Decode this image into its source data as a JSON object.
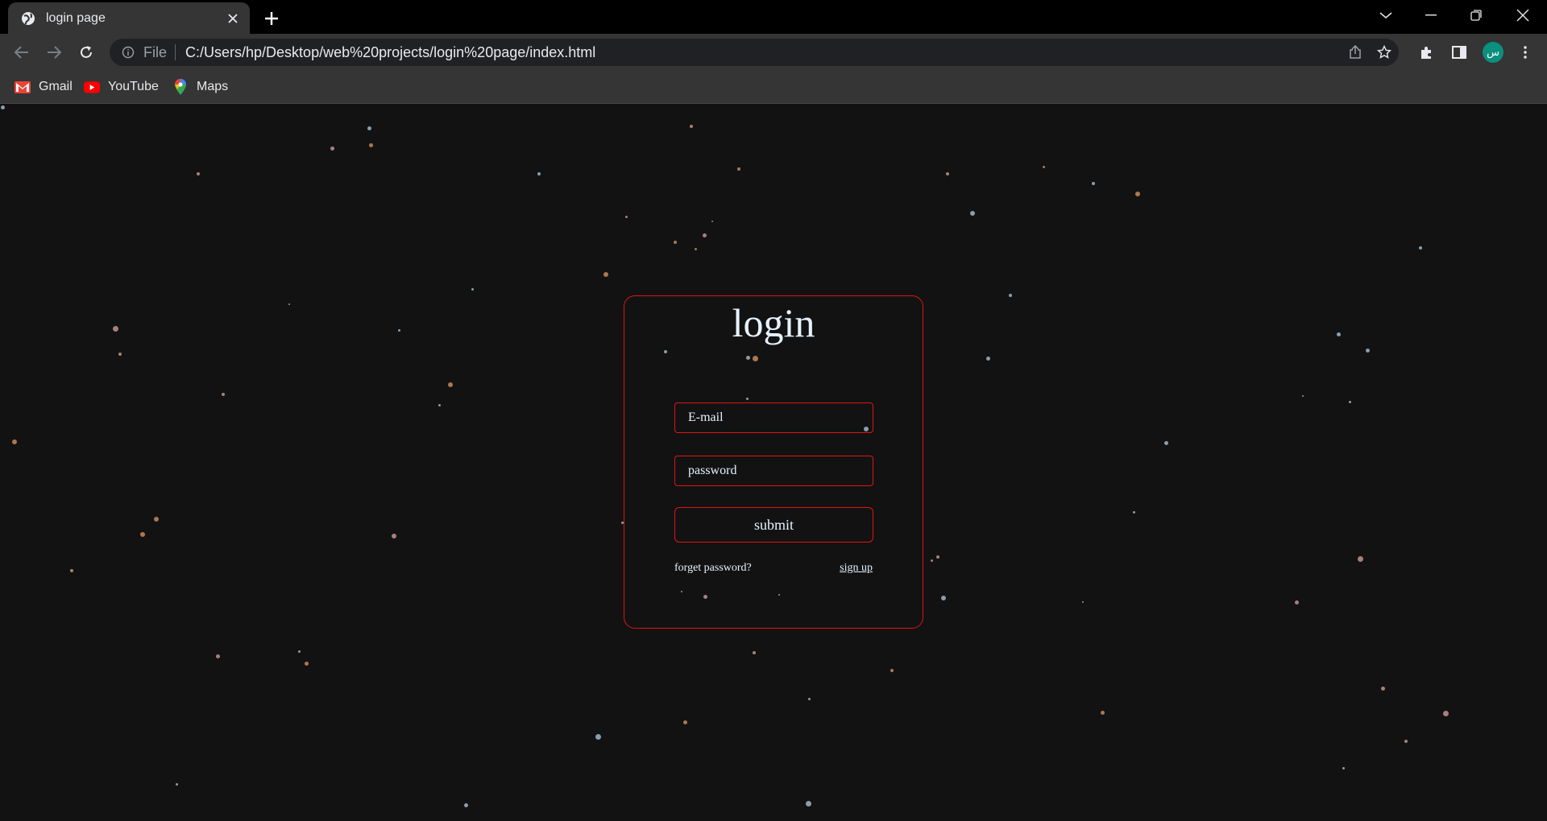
{
  "browser": {
    "tab": {
      "title": "login page",
      "favicon": "globe-icon"
    },
    "omnibox": {
      "scheme": "File",
      "url": "C:/Users/hp/Desktop/web%20projects/login%20page/index.html"
    },
    "profile_initial": "س",
    "accent_color": "#0b8f7e"
  },
  "bookmarks": [
    {
      "label": "Gmail",
      "icon": "gmail-icon"
    },
    {
      "label": "YouTube",
      "icon": "youtube-icon"
    },
    {
      "label": "Maps",
      "icon": "maps-icon"
    }
  ],
  "login": {
    "title": "login",
    "email_placeholder": "E-mail",
    "password_placeholder": "password",
    "submit_label": "submit",
    "forget_label": "forget password?",
    "signup_label": "sign up",
    "border_color": "#e01414",
    "text_color": "#e6f2ff"
  },
  "background": {
    "color": "#121212",
    "particle_colors": [
      "#c98a5c",
      "#9fb6c8",
      "#c39390"
    ]
  }
}
